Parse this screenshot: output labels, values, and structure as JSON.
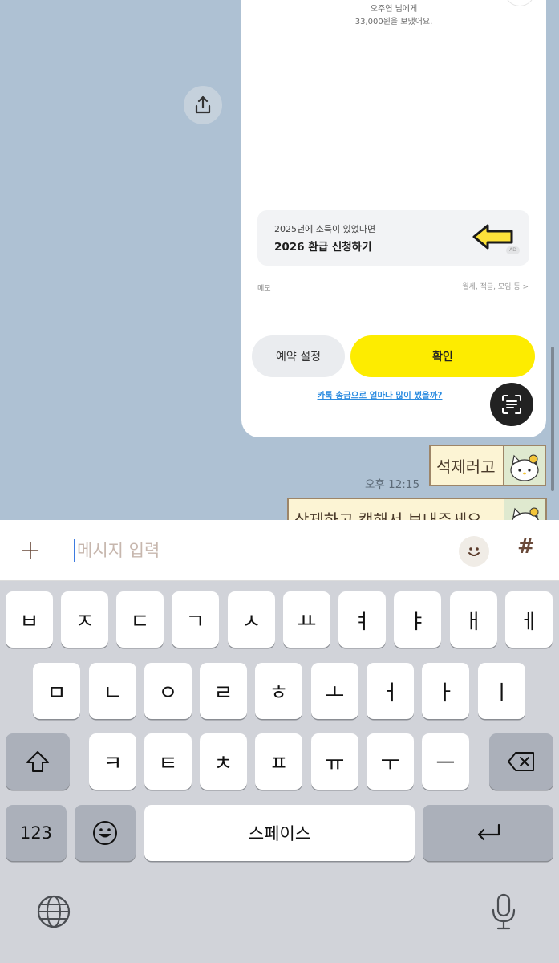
{
  "card": {
    "recipient_line": "오주연 님에게",
    "amount_line": "33,000원을 보냈어요.",
    "refund_sub": "2025년에 소득이 있었다면",
    "refund_title": "2026 환급 신청하기",
    "ad_badge": "AD",
    "memo_label": "메모",
    "memo_hint": "월세, 적금, 모임 등 >",
    "reserve_label": "예약 설정",
    "confirm_label": "확인",
    "spend_link": "카톡 송금으로 얼마나 많이 썼을까?"
  },
  "messages": [
    {
      "text": "석제러고",
      "sticker": "hello-kitty"
    },
    {
      "text": "삭제하고 캡해서 보내주세요",
      "sticker": "hello-kitty"
    }
  ],
  "time_1": "오후 12:15",
  "input": {
    "placeholder": "메시지 입력",
    "hash": "#",
    "plus": "+"
  },
  "keyboard": {
    "row1": [
      "ㅂ",
      "ㅈ",
      "ㄷ",
      "ㄱ",
      "ㅅ",
      "ㅛ",
      "ㅕ",
      "ㅑ",
      "ㅐ",
      "ㅔ"
    ],
    "row2": [
      "ㅁ",
      "ㄴ",
      "ㅇ",
      "ㄹ",
      "ㅎ",
      "ㅗ",
      "ㅓ",
      "ㅏ",
      "ㅣ"
    ],
    "row3": [
      "ㅋ",
      "ㅌ",
      "ㅊ",
      "ㅍ",
      "ㅠ",
      "ㅜ",
      "ㅡ"
    ],
    "numbers_label": "123",
    "space_label": "스페이스"
  },
  "icons": {
    "share": "share-icon",
    "arrow": "left-arrow-icon",
    "scan": "scan-text-icon",
    "emoji": "smiley-icon",
    "shift": "shift-icon",
    "delete": "backspace-icon",
    "return": "return-icon",
    "globe": "globe-icon",
    "mic": "microphone-icon"
  },
  "colors": {
    "chat_bg": "#aec1d3",
    "confirm_yellow": "#fdec00",
    "link_blue": "#2c8ce0",
    "keyboard_bg": "#d1d3d9"
  }
}
